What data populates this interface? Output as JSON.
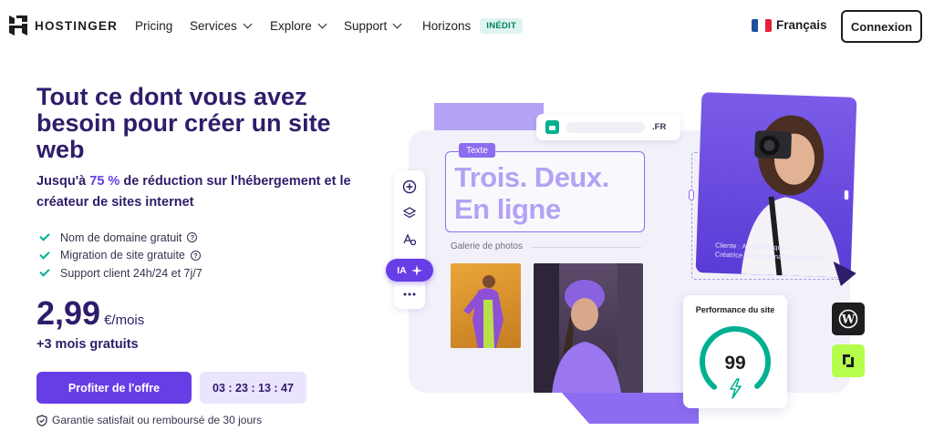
{
  "nav": {
    "brand": "HOSTINGER",
    "links": [
      {
        "label": "Pricing"
      },
      {
        "label": "Services"
      },
      {
        "label": "Explore"
      },
      {
        "label": "Support"
      },
      {
        "label": "Horizons"
      }
    ],
    "new_badge": "INÉDIT",
    "language": "Français",
    "login_label": "Connexion"
  },
  "hero": {
    "title": "Tout ce dont vous avez besoin pour créer un site web",
    "subtitle_prefix": "Jusqu'à",
    "subtitle_percent": "75 %",
    "subtitle_suffix": "de réduction sur l'hébergement et le créateur de sites internet",
    "features": [
      {
        "label": "Nom de domaine gratuit",
        "info": true
      },
      {
        "label": "Migration de site gratuite",
        "info": true
      },
      {
        "label": "Support client 24h/24 et 7j/7",
        "info": false
      }
    ],
    "price": "2,99",
    "price_unit": "€/mois",
    "bonus": "+3 mois gratuits",
    "cta_label": "Profiter de l'offre",
    "timer": "03 : 23 : 13 : 47",
    "guarantee": "Garantie satisfait ou remboursé de 30 jours"
  },
  "illustration": {
    "url_tld": ".FR",
    "text_tag": "Texte",
    "headline_line1": "Trois. Deux.",
    "headline_line2": "En ligne",
    "gallery_label": "Galerie de photos",
    "ia_label": "IA",
    "photo_caption_line1": "Cliente : Anna Franquez",
    "photo_caption_line2": "Créatrice du site annafranquez.com",
    "performance_title": "Performance du site",
    "performance_score": "99",
    "performance_level": 0.99
  },
  "colors": {
    "primary": "#673de6",
    "navy": "#2f1c6a",
    "green": "#00b090",
    "lime": "#b5ff4c"
  }
}
